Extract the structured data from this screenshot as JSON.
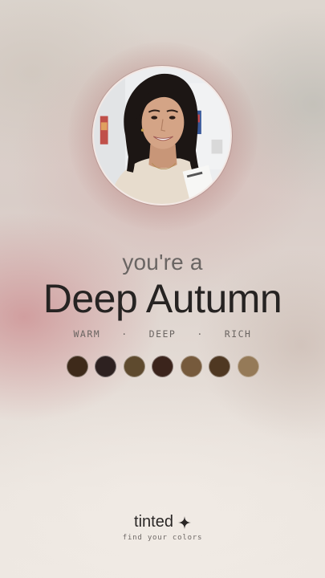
{
  "result": {
    "intro": "you're a",
    "season": "Deep Autumn",
    "traits": [
      "WARM",
      "DEEP",
      "RICH"
    ],
    "separator": "·"
  },
  "palette": {
    "swatches": [
      "#3e2a1a",
      "#2d2120",
      "#5e4a2e",
      "#3b241c",
      "#765a3c",
      "#4f3822",
      "#957a58"
    ]
  },
  "brand": {
    "name": "tinted",
    "icon": "sparkle-icon",
    "tagline": "find your colors"
  },
  "portrait": {
    "icon": "user-portrait"
  }
}
